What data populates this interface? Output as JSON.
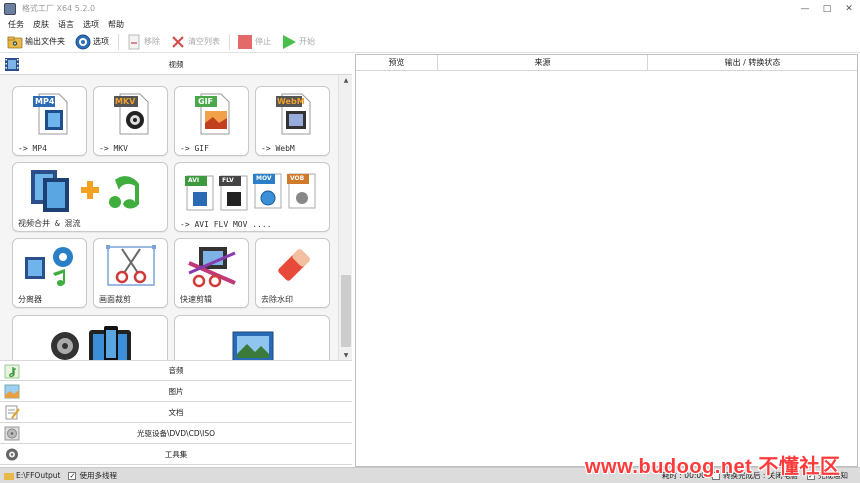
{
  "window": {
    "title": "格式工厂 X64 5.2.0",
    "controls": [
      "—",
      "□",
      "✕"
    ]
  },
  "menu": [
    "任务",
    "皮肤",
    "语言",
    "选项",
    "帮助"
  ],
  "toolbar": {
    "output_folder": "输出文件夹",
    "options": "选项",
    "remove": "移除",
    "clear_list": "清空列表",
    "stop": "停止",
    "start": "开始"
  },
  "categories": {
    "video": "视频",
    "audio": "音频",
    "image": "图片",
    "document": "文档",
    "disc": "光驱设备\\DVD\\CD\\ISO",
    "tools": "工具集"
  },
  "tiles": {
    "mp4": {
      "label": "-> MP4",
      "badge": "MP4"
    },
    "mkv": {
      "label": "-> MKV",
      "badge": "MKV"
    },
    "gif": {
      "label": "-> GIF",
      "badge": "GIF"
    },
    "webm": {
      "label": "-> WebM",
      "badge": "WebM"
    },
    "merge": {
      "label": "视频合并 & 混流"
    },
    "avi": {
      "label": "-> AVI FLV MOV ....",
      "badges": [
        "AVI",
        "FLV",
        "MOV",
        "VOB"
      ]
    },
    "splitter": {
      "label": "分离器"
    },
    "crop": {
      "label": "画面裁剪"
    },
    "quick_cut": {
      "label": "快速剪辑"
    },
    "watermark": {
      "label": "去除水印"
    }
  },
  "task_columns": [
    "预览",
    "来源",
    "输出 / 转换状态"
  ],
  "status": {
    "output_path": "E:\\FFOutput",
    "multithread": "使用多线程",
    "elapsed": "耗时 : 00:00:00",
    "after_convert": "转换完成后 : 关闭电脑",
    "notify": "完成通知"
  },
  "watermark_text": "www.budoog.net 不懂社区",
  "colors": {
    "mp4": "#2e6bb5",
    "mkv": "#f0a02a",
    "gif": "#48a84a",
    "webm": "#7b5bb0",
    "avi": "#3f9a3f",
    "flv": "#444444",
    "mov": "#2a7fc7",
    "vob": "#d07a2a",
    "stop": "#e46a6a",
    "start": "#4bbf4b"
  }
}
